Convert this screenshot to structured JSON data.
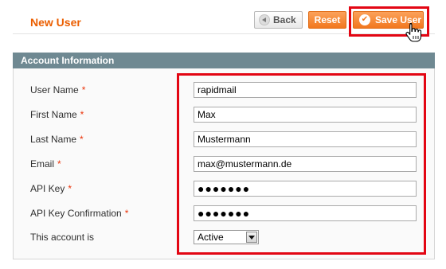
{
  "header": {
    "title": "New User",
    "buttons": {
      "back_label": "Back",
      "reset_label": "Reset",
      "save_label": "Save User"
    }
  },
  "fieldset": {
    "legend": "Account Information",
    "required_marker": "*",
    "fields": [
      {
        "label": "User Name",
        "required": true,
        "value": "rapidmail",
        "type": "text"
      },
      {
        "label": "First Name",
        "required": true,
        "value": "Max",
        "type": "text"
      },
      {
        "label": "Last Name",
        "required": true,
        "value": "Mustermann",
        "type": "text"
      },
      {
        "label": "Email",
        "required": true,
        "value": "max@mustermann.de",
        "type": "text"
      },
      {
        "label": "API Key",
        "required": true,
        "value": "●●●●●●●",
        "type": "password"
      },
      {
        "label": "API Key Confirmation",
        "required": true,
        "value": "●●●●●●●",
        "type": "password"
      },
      {
        "label": "This account is",
        "required": false,
        "value": "Active",
        "type": "select"
      }
    ]
  },
  "colors": {
    "title": "#eb5e00",
    "button_orange": "#f2781e",
    "fieldset_header": "#6f8992",
    "highlight": "#e30613",
    "required": "#eb340a"
  },
  "icons": {
    "back": "back-arrow-icon",
    "save": "check-circle-icon",
    "cursor": "hand-pointer-icon",
    "select": "chevron-down-icon"
  }
}
